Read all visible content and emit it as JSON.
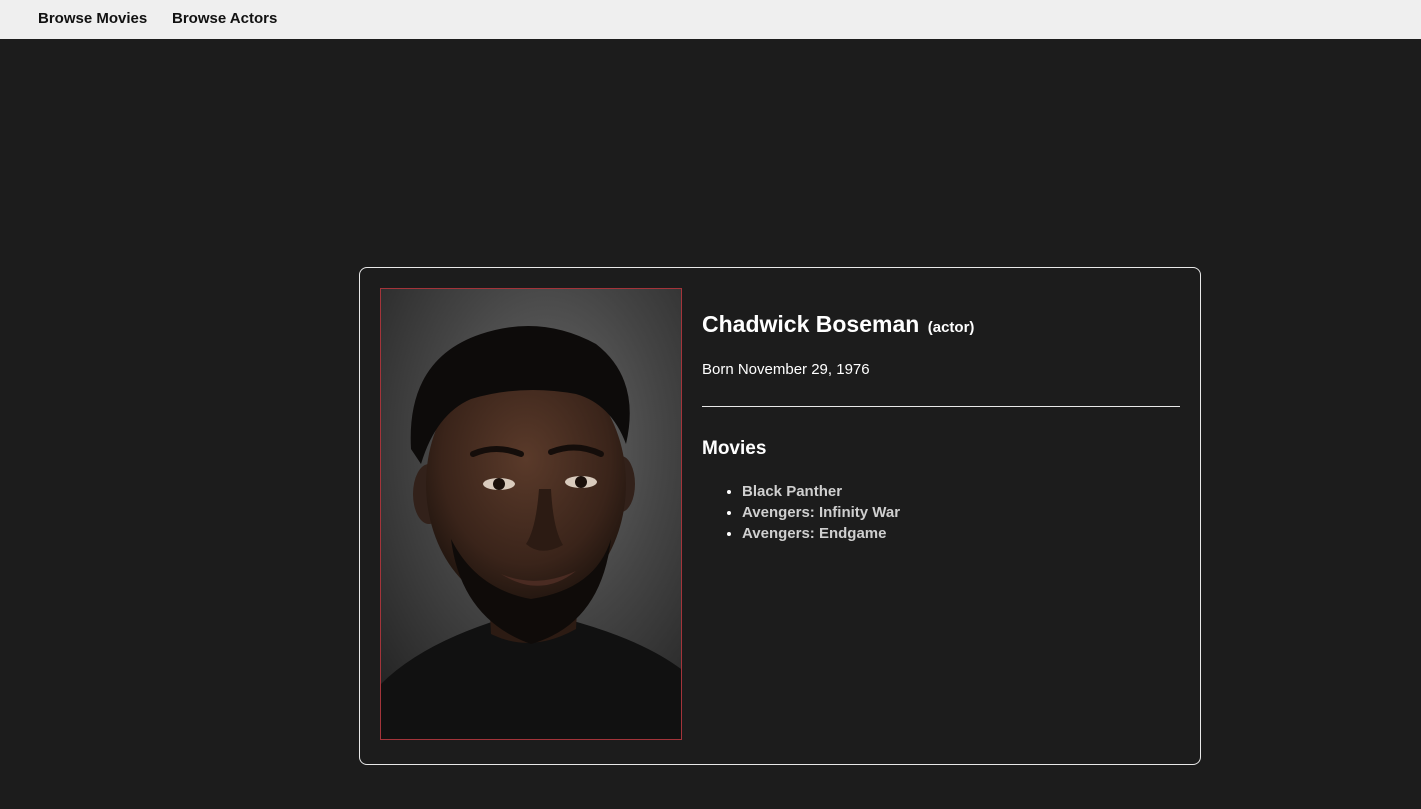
{
  "nav": {
    "browse_movies": "Browse Movies",
    "browse_actors": "Browse Actors"
  },
  "actor": {
    "name": "Chadwick Boseman",
    "role": "(actor)",
    "born": "Born November 29, 1976",
    "photo_alt": "Chadwick Boseman portrait"
  },
  "movies": {
    "heading": "Movies",
    "items": [
      "Black Panther",
      "Avengers: Infinity War",
      "Avengers: Endgame"
    ]
  },
  "colors": {
    "background": "#1c1c1c",
    "nav_background": "#efefef",
    "card_border": "#e8e8e8",
    "photo_border": "#a3343a",
    "link_text": "#cfcfcf"
  }
}
